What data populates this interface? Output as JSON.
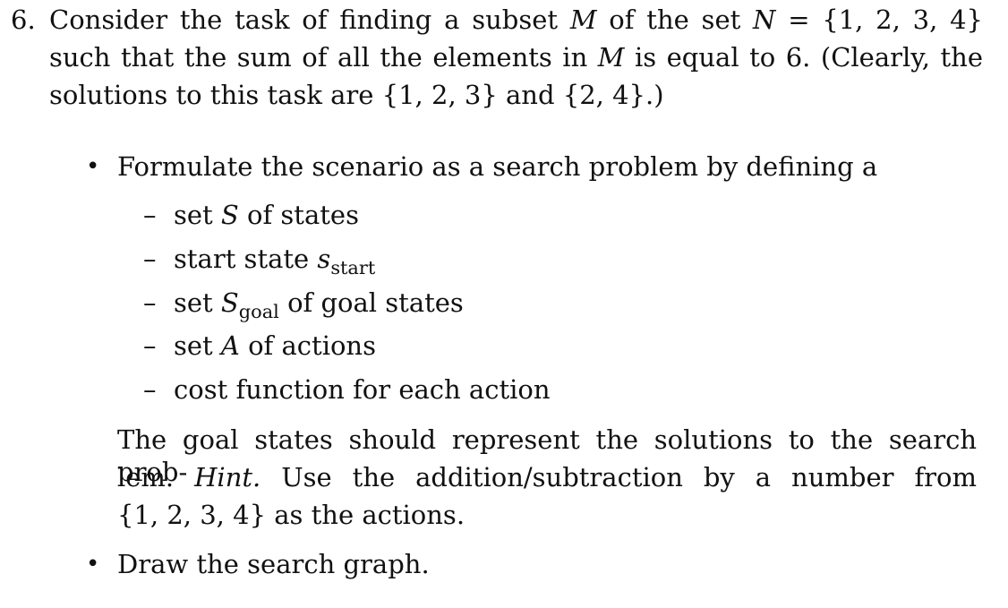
{
  "problem": {
    "number": "6.",
    "line1": {
      "a": "Consider the task of finding a subset ",
      "M": "M",
      "b": " of the set ",
      "N": "N",
      "c": " = ",
      "set": "{1, 2, 3, 4}"
    },
    "line2": {
      "a": "such that the sum of all the elements in ",
      "M": "M",
      "b": " is equal to 6. (Clearly, the"
    },
    "line3": {
      "a": "solutions to this task are ",
      "sol1": "{1, 2, 3}",
      "b": " and ",
      "sol2": "{2, 4}",
      "c": ".)"
    }
  },
  "bullets": [
    {
      "symbol": "•",
      "text": "Formulate the scenario as a search problem by defining a"
    },
    {
      "symbol": "•",
      "text": "Draw the search graph."
    }
  ],
  "subitems": [
    {
      "dash": "–",
      "a": "set ",
      "var": "S",
      "sub": "",
      "b": " of states"
    },
    {
      "dash": "–",
      "a": "start state ",
      "var": "s",
      "sub": "start",
      "b": ""
    },
    {
      "dash": "–",
      "a": "set ",
      "var": "S",
      "sub": "goal",
      "b": " of goal states"
    },
    {
      "dash": "–",
      "a": "set ",
      "var": "A",
      "sub": "",
      "b": " of actions"
    },
    {
      "dash": "–",
      "a": "cost function for each action",
      "var": "",
      "sub": "",
      "b": ""
    }
  ],
  "paragraph": {
    "line1": "The goal states should represent the solutions to the search prob-",
    "line2a": "lem.",
    "line2hint": "Hint.",
    "line2b": "Use the addition/subtraction by a number from",
    "line3set": "{1, 2, 3, 4}",
    "line3b": " as the actions."
  }
}
